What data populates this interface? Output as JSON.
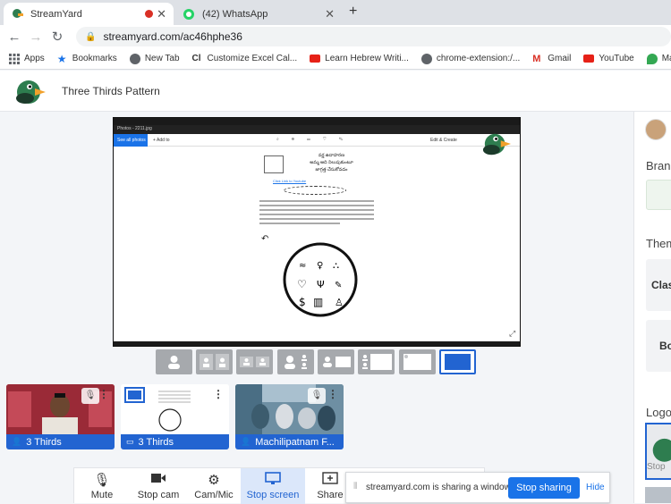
{
  "browser": {
    "tabs": [
      {
        "title": "StreamYard",
        "active": true
      },
      {
        "title": "(42) WhatsApp",
        "active": false
      }
    ],
    "new_tab_glyph": "+",
    "url": "streamyard.com/ac46hphe36",
    "bookmarks": [
      {
        "label": "Apps",
        "icon": "apps-grid-icon",
        "color": "#5f6368"
      },
      {
        "label": "Bookmarks",
        "icon": "star-icon",
        "color": "#1a73e8"
      },
      {
        "label": "New Tab",
        "icon": "globe-icon",
        "color": "#5f6368"
      },
      {
        "label": "Customize Excel Cal...",
        "icon": "cl-icon",
        "color": "#222"
      },
      {
        "label": "Learn Hebrew Writi...",
        "icon": "youtube-icon",
        "color": "#e62117"
      },
      {
        "label": "chrome-extension:/...",
        "icon": "globe-icon",
        "color": "#5f6368"
      },
      {
        "label": "Gmail",
        "icon": "gmail-icon",
        "color": "#d93025"
      },
      {
        "label": "YouTube",
        "icon": "youtube-icon",
        "color": "#e62117"
      },
      {
        "label": "Maps",
        "icon": "maps-icon",
        "color": "#34a853"
      }
    ]
  },
  "app": {
    "title": "Three Thirds Pattern",
    "brand_colors": {
      "accent": "#2264d1",
      "highlight": "#dbe7fa"
    }
  },
  "stage": {
    "viewer_tab": "Photos - 2211.jpg",
    "viewer_label": "See all photos",
    "viewer_add": "+ Add to",
    "viewer_edit": "Edit & Create",
    "doc_lines": [
      "వర్ణ ఉదాహరణ",
      "అమ్మ ఆది నిలుపుకుంటూ",
      "జాగ్రత్త చేసుకోవడం"
    ],
    "doc_link": "Click Link to Youtube"
  },
  "layouts": {
    "count": 8,
    "selected_index": 7
  },
  "participants": [
    {
      "name": "3 Thirds",
      "type": "camera"
    },
    {
      "name": "3 Thirds",
      "type": "screen"
    },
    {
      "name": "Machilipatnam F...",
      "type": "camera"
    }
  ],
  "controls": [
    {
      "label": "Mute",
      "icon": "microphone-icon",
      "glyph": "🎙"
    },
    {
      "label": "Stop cam",
      "icon": "camera-icon",
      "glyph": "■"
    },
    {
      "label": "Cam/Mic",
      "icon": "gear-icon",
      "glyph": "⚙"
    },
    {
      "label": "Stop screen",
      "icon": "monitor-icon",
      "glyph": "▭",
      "active": true
    },
    {
      "label": "Share",
      "icon": "share-plus-icon",
      "glyph": "⊞"
    }
  ],
  "share_notice": {
    "text": "streamyard.com is sharing a window.",
    "stop_label": "Stop sharing",
    "hide_label": "Hide"
  },
  "right_panel": {
    "brand_label": "Brand",
    "themes_label": "Themes",
    "theme_1": "Classic",
    "theme_2": "Bold",
    "logo_label": "Logo",
    "logo_caption": "Stop"
  }
}
